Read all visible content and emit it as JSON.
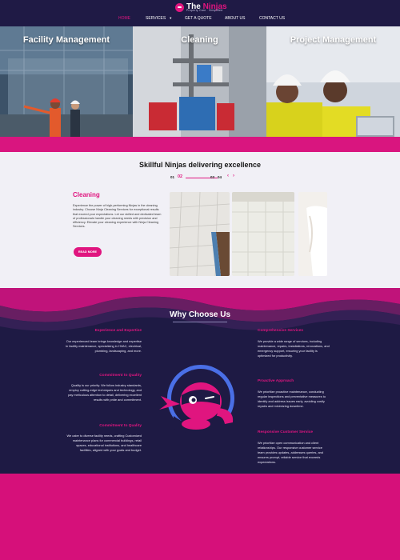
{
  "brand": {
    "name_part1": "The ",
    "name_part2": "Ninjas",
    "tagline": "Property Care · Simplified"
  },
  "nav": {
    "items": [
      {
        "label": "HOME",
        "active": true
      },
      {
        "label": "SERVICES",
        "has_dropdown": true
      },
      {
        "label": "GET A QUOTE"
      },
      {
        "label": "ABOUT US"
      },
      {
        "label": "CONTACT US"
      }
    ]
  },
  "hero": {
    "panels": [
      {
        "title": "Facility Management"
      },
      {
        "title": "Cleaning"
      },
      {
        "title": "Project Management"
      }
    ]
  },
  "skill": {
    "title": "Skillful Ninjas delivering excellence",
    "pager": {
      "prev_num": "01",
      "current": "02",
      "next1": "03",
      "next2": "04",
      "prev_arrow": "‹",
      "next_arrow": "›"
    },
    "service_title": "Cleaning",
    "service_text": "Experience the power of high-performing Ninjas in the cleaning industry. Choose Ninja Cleaning Services for exceptional results that exceed your expectations. Let our skilled and dedicated team of professionals handle your cleaning needs with precision and efficiency. Elevate your cleaning experience with Ninja Cleaning Services.",
    "button": "READ MORE"
  },
  "why": {
    "title": "Why Choose Us",
    "left": [
      {
        "heading": "Experience and Expertise",
        "text": "Our experienced team brings knowledge and expertise in facility maintenance, specializing in HVAC, electrical, plumbing, landscaping, and more."
      },
      {
        "heading": "Commitment to Quality",
        "text": "Quality is our priority. We follow industry standards, employ cutting-edge techniques and technology, and pay meticulous attention to detail, delivering excellent results with pride and commitment."
      },
      {
        "heading": "Commitment to Quality",
        "text": "We cater to diverse facility needs, crafting Customized maintenance plans for commercial buildings, retail spaces, educational institutions, and healthcare facilities, aligned with your goals and budget."
      }
    ],
    "right": [
      {
        "heading": "Comprehensive Services",
        "text": "We provide a wide range of services, including maintenance, repairs, installations, renovations, and emergency support, ensuring your facility is optimized for productivity."
      },
      {
        "heading": "Proactive Approach",
        "text": "We prioritize proactive maintenance, conducting regular inspections and preventative measures to identify and address issues early, avoiding costly repairs and minimizing downtime."
      },
      {
        "heading": "Responsive Customer Service",
        "text": "We prioritize open communication and client relationships. Our responsive customer service team provides updates, addresses queries, and ensures prompt, reliable service that exceeds expectations."
      }
    ]
  },
  "colors": {
    "primary": "#e0157f",
    "navy": "#1f1a45",
    "light": "#f1f0f6"
  }
}
